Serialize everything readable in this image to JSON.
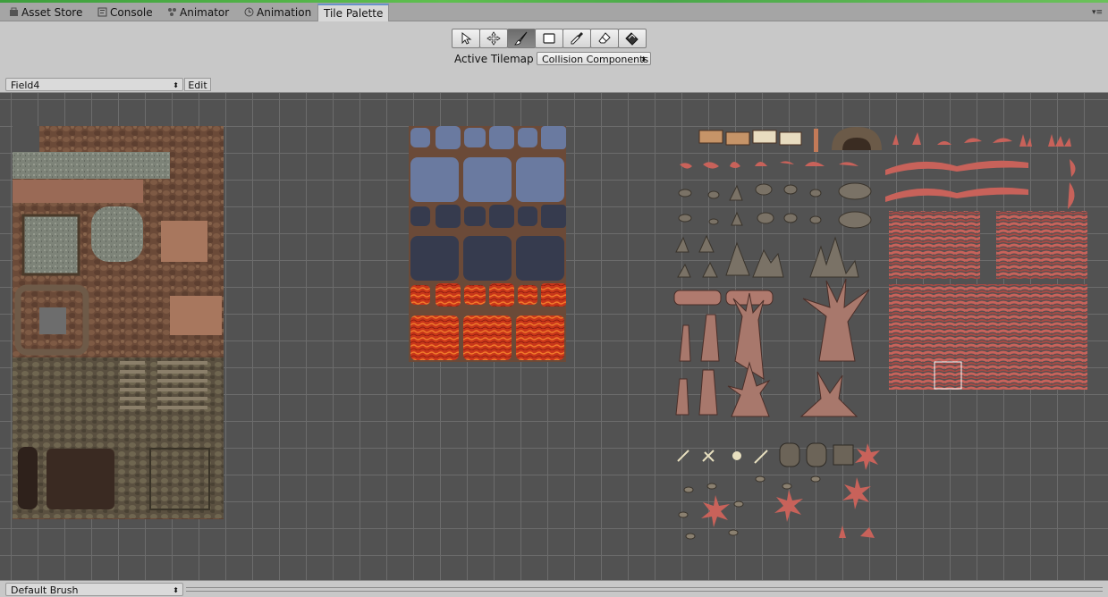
{
  "tabs": [
    {
      "label": "Asset Store",
      "icon": "store-icon"
    },
    {
      "label": "Console",
      "icon": "console-icon"
    },
    {
      "label": "Animator",
      "icon": "animator-icon"
    },
    {
      "label": "Animation",
      "icon": "clock-icon"
    },
    {
      "label": "Tile Palette",
      "icon": "",
      "active": true
    }
  ],
  "toolbar": {
    "tools": [
      {
        "name": "select-tool",
        "icon": "pointer-icon"
      },
      {
        "name": "move-tool",
        "icon": "move-icon"
      },
      {
        "name": "paint-tool",
        "icon": "brush-icon",
        "active": true
      },
      {
        "name": "box-fill-tool",
        "icon": "rectangle-icon"
      },
      {
        "name": "picker-tool",
        "icon": "eyedropper-icon"
      },
      {
        "name": "erase-tool",
        "icon": "eraser-icon"
      },
      {
        "name": "flood-fill-tool",
        "icon": "bucket-icon"
      }
    ],
    "active_tilemap_label": "Active Tilemap",
    "active_tilemap_value": "Collision Components"
  },
  "palette": {
    "selected": "Field4",
    "edit_label": "Edit"
  },
  "brush": {
    "selected": "Default Brush"
  },
  "colors": {
    "grid_bg": "#525252",
    "grid_line": "#6c6c6c",
    "tab_accent": "#6a92c9",
    "tool_active": "#6c6c6c"
  }
}
